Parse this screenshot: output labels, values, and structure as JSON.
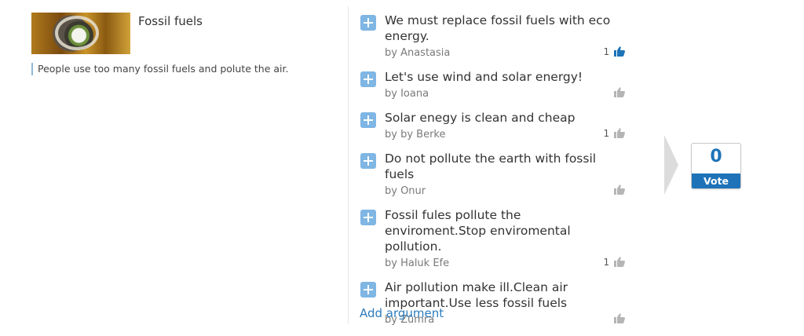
{
  "topic": {
    "title": "Fossil fuels",
    "description": "People use too many fossil fuels and polute the air."
  },
  "arguments": [
    {
      "text": "We must replace fossil fuels with eco energy.",
      "author": "by Anastasia",
      "likes": "1",
      "liked": true
    },
    {
      "text": "Let's use wind and solar energy!",
      "author": "by Ioana",
      "likes": "",
      "liked": false
    },
    {
      "text": "Solar enegy is clean and cheap",
      "author": "by by Berke",
      "likes": "1",
      "liked": false
    },
    {
      "text": "Do not pollute the earth with fossil fuels",
      "author": "by Onur",
      "likes": "",
      "liked": false
    },
    {
      "text": "Fossil fules pollute the enviroment.Stop enviromental pollution.",
      "author": "by Haluk Efe",
      "likes": "1",
      "liked": false
    },
    {
      "text": "Air pollution make ill.Clean air important.Use less fossil fuels",
      "author": "by Zümra",
      "likes": "",
      "liked": false
    }
  ],
  "add_argument_label": "Add argument",
  "vote": {
    "count": "0",
    "label": "Vote"
  },
  "colors": {
    "accent": "#1e73b8",
    "plus_icon": "#7fb6e3",
    "thumb_liked": "#1e73b8",
    "thumb_default": "#b5b5b5"
  },
  "icons": {
    "add": "plus-icon",
    "like": "thumbs-up-icon",
    "arrow": "chevron-right-icon"
  }
}
